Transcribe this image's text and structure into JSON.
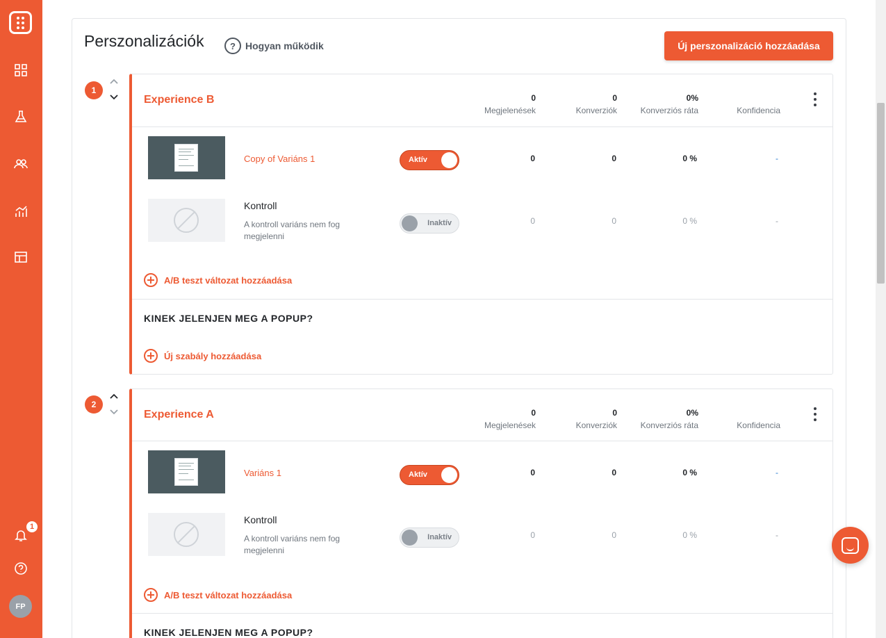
{
  "page": {
    "title": "Perszonalizációk",
    "how_link": "Hogyan működik",
    "add_button": "Új perszonalizáció hozzáadása"
  },
  "sidebar": {
    "icons": [
      "dashboard-icon",
      "flask-icon",
      "users-icon",
      "analytics-icon",
      "layout-icon",
      "bell-icon",
      "help-icon"
    ],
    "notification_count": "1",
    "avatar_initials": "FP"
  },
  "stat_labels": {
    "impressions": "Megjelenések",
    "conversions": "Konverziók",
    "conversion_rate": "Konverziós ráta",
    "confidence": "Konfidencia"
  },
  "experiences": [
    {
      "index": "1",
      "name": "Experience B",
      "impressions": "0",
      "conversions": "0",
      "conversion_rate": "0%",
      "variants": [
        {
          "name": "Copy of Variáns 1",
          "status": "Aktív",
          "impressions": "0",
          "conversions": "0",
          "rate": "0 %",
          "confidence": "-"
        },
        {
          "name": "Kontroll",
          "description": "A kontroll variáns nem fog megjelenni",
          "status": "Inaktív",
          "impressions": "0",
          "conversions": "0",
          "rate": "0 %",
          "confidence": "-"
        }
      ],
      "add_variant": "A/B teszt változat hozzáadása",
      "audience_heading": "KINEK JELENJEN MEG A POPUP?",
      "add_rule": "Új szabály hozzáadása"
    },
    {
      "index": "2",
      "name": "Experience A",
      "impressions": "0",
      "conversions": "0",
      "conversion_rate": "0%",
      "variants": [
        {
          "name": "Variáns 1",
          "status": "Aktív",
          "impressions": "0",
          "conversions": "0",
          "rate": "0 %",
          "confidence": "-"
        },
        {
          "name": "Kontroll",
          "description": "A kontroll variáns nem fog megjelenni",
          "status": "Inaktív",
          "impressions": "0",
          "conversions": "0",
          "rate": "0 %",
          "confidence": "-"
        }
      ],
      "add_variant": "A/B teszt változat hozzáadása",
      "audience_heading": "KINEK JELENJEN MEG A POPUP?"
    }
  ],
  "colors": {
    "brand": "#ed5a33",
    "link_blue": "#2a7bd0"
  }
}
